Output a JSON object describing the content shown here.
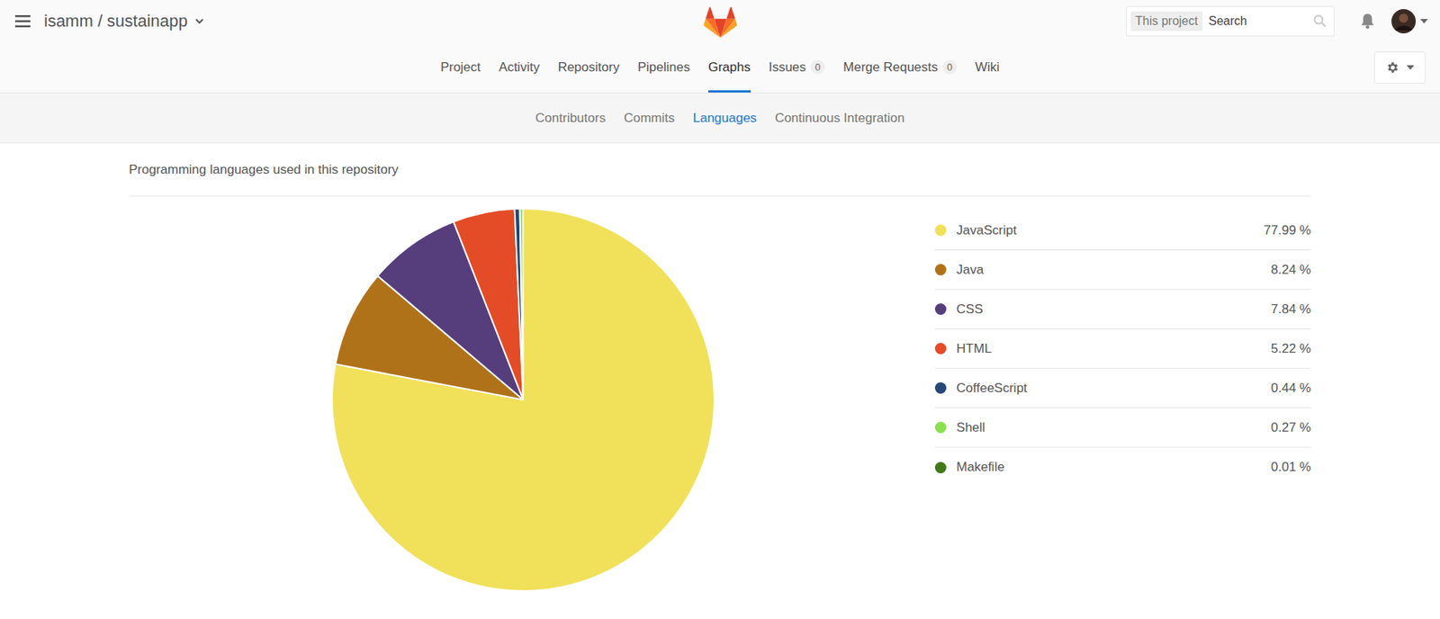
{
  "header": {
    "project_path": "isamm / sustainapp",
    "search": {
      "scope": "This project",
      "placeholder": "Search"
    }
  },
  "nav": [
    {
      "label": "Project",
      "selected": false,
      "count": null
    },
    {
      "label": "Activity",
      "selected": false,
      "count": null
    },
    {
      "label": "Repository",
      "selected": false,
      "count": null
    },
    {
      "label": "Pipelines",
      "selected": false,
      "count": null
    },
    {
      "label": "Graphs",
      "selected": true,
      "count": null
    },
    {
      "label": "Issues",
      "selected": false,
      "count": "0"
    },
    {
      "label": "Merge Requests",
      "selected": false,
      "count": "0"
    },
    {
      "label": "Wiki",
      "selected": false,
      "count": null
    }
  ],
  "subnav": [
    {
      "label": "Contributors",
      "selected": false
    },
    {
      "label": "Commits",
      "selected": false
    },
    {
      "label": "Languages",
      "selected": true
    },
    {
      "label": "Continuous Integration",
      "selected": false
    }
  ],
  "chart": {
    "title": "Programming languages used in this repository",
    "languages": [
      {
        "name": "JavaScript",
        "value": 77.99,
        "percent": "77.99 %",
        "color": "#f1e05a"
      },
      {
        "name": "Java",
        "value": 8.24,
        "percent": "8.24 %",
        "color": "#b07219"
      },
      {
        "name": "CSS",
        "value": 7.84,
        "percent": "7.84 %",
        "color": "#563d7c"
      },
      {
        "name": "HTML",
        "value": 5.22,
        "percent": "5.22 %",
        "color": "#e34c26"
      },
      {
        "name": "CoffeeScript",
        "value": 0.44,
        "percent": "0.44 %",
        "color": "#244776"
      },
      {
        "name": "Shell",
        "value": 0.27,
        "percent": "0.27 %",
        "color": "#89e051"
      },
      {
        "name": "Makefile",
        "value": 0.01,
        "percent": "0.01 %",
        "color": "#427819"
      }
    ]
  }
}
